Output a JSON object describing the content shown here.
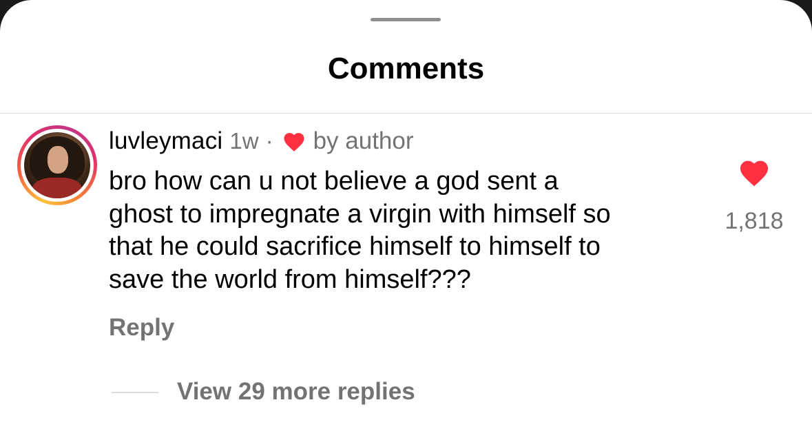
{
  "sheet": {
    "title": "Comments"
  },
  "comment": {
    "username": "luvleymaci",
    "time": "1w",
    "separator": "·",
    "author_badge": "by author",
    "text_lines": [
      "bro how can u not believe a god sent a",
      "ghost to impregnate a virgin with himself so",
      "that he could sacrifice himself to himself to",
      "save the world from himself???"
    ],
    "reply_label": "Reply",
    "like_count": "1,818",
    "liked": true,
    "view_replies_label": "View 29 more replies"
  },
  "icons": {
    "author_like": "heart-icon",
    "like": "heart-icon"
  },
  "colors": {
    "like_red": "#ff3040",
    "secondary_text": "#737373"
  }
}
